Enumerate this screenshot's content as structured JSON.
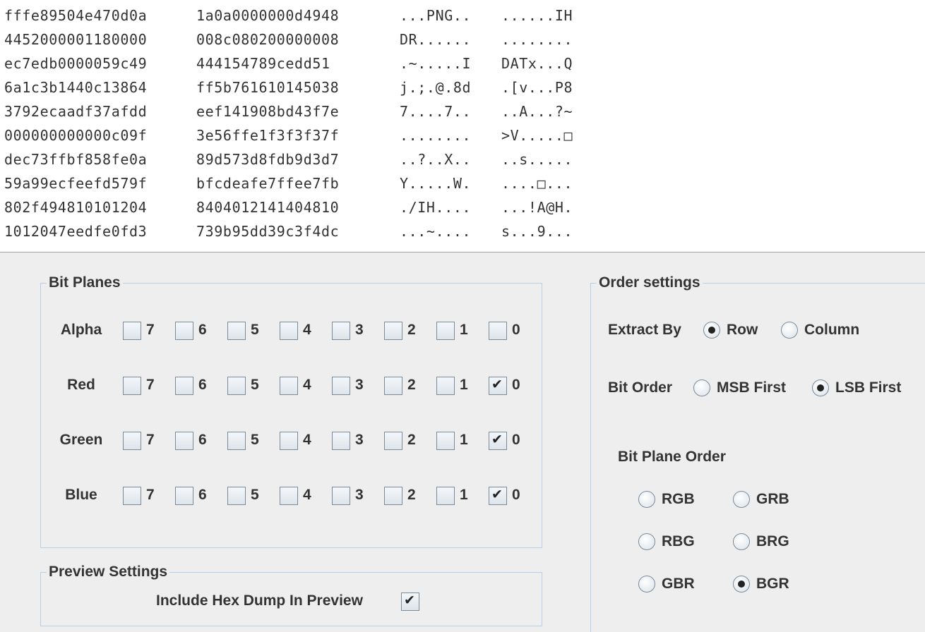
{
  "hex_dump": {
    "lines": [
      {
        "hex1": "fffe89504e470d0a",
        "hex2": "1a0a0000000d4948",
        "ascii1": "...PNG..",
        "ascii2": "......IH"
      },
      {
        "hex1": "4452000001180000",
        "hex2": "008c080200000008",
        "ascii1": "DR......",
        "ascii2": "........"
      },
      {
        "hex1": "ec7edb0000059c49",
        "hex2": "444154789cedd51",
        "ascii1": ".~.....I",
        "ascii2": "DATx...Q"
      },
      {
        "hex1": "6a1c3b1440c13864",
        "hex2": "ff5b761610145038",
        "ascii1": "j.;.@.8d",
        "ascii2": ".[v...P8"
      },
      {
        "hex1": "3792ecaadf37afdd",
        "hex2": "eef141908bd43f7e",
        "ascii1": "7....7..",
        "ascii2": "..A...?~"
      },
      {
        "hex1": "000000000000c09f",
        "hex2": "3e56ffe1f3f3f37f",
        "ascii1": "........",
        "ascii2": ">V.....□"
      },
      {
        "hex1": "dec73ffbf858fe0a",
        "hex2": "89d573d8fdb9d3d7",
        "ascii1": "..?..X..",
        "ascii2": "..s....."
      },
      {
        "hex1": "59a99ecfeefd579f",
        "hex2": "bfcdeafe7ffee7fb",
        "ascii1": "Y.....W.",
        "ascii2": "....□..."
      },
      {
        "hex1": "802f494810101204",
        "hex2": "8404012141404810",
        "ascii1": "./IH....",
        "ascii2": "...!A@H."
      },
      {
        "hex1": "1012047eedfe0fd3",
        "hex2": "739b95dd39c3f4dc",
        "ascii1": "...~....",
        "ascii2": "s...9..."
      }
    ]
  },
  "bit_planes": {
    "title": "Bit Planes",
    "rows": [
      {
        "label": "Alpha",
        "bits": [
          "7",
          "6",
          "5",
          "4",
          "3",
          "2",
          "1",
          "0"
        ],
        "checked": [
          false,
          false,
          false,
          false,
          false,
          false,
          false,
          false
        ]
      },
      {
        "label": "Red",
        "bits": [
          "7",
          "6",
          "5",
          "4",
          "3",
          "2",
          "1",
          "0"
        ],
        "checked": [
          false,
          false,
          false,
          false,
          false,
          false,
          false,
          true
        ]
      },
      {
        "label": "Green",
        "bits": [
          "7",
          "6",
          "5",
          "4",
          "3",
          "2",
          "1",
          "0"
        ],
        "checked": [
          false,
          false,
          false,
          false,
          false,
          false,
          false,
          true
        ]
      },
      {
        "label": "Blue",
        "bits": [
          "7",
          "6",
          "5",
          "4",
          "3",
          "2",
          "1",
          "0"
        ],
        "checked": [
          false,
          false,
          false,
          false,
          false,
          false,
          false,
          true
        ]
      }
    ]
  },
  "preview_settings": {
    "title": "Preview Settings",
    "include_hex_label": "Include Hex Dump In Preview",
    "include_hex_checked": true
  },
  "order_settings": {
    "title": "Order settings",
    "extract_by": {
      "label": "Extract By",
      "options": [
        "Row",
        "Column"
      ],
      "selected": "Row"
    },
    "bit_order": {
      "label": "Bit Order",
      "options": [
        "MSB First",
        "LSB First"
      ],
      "selected": "LSB First"
    },
    "bit_plane_order": {
      "label": "Bit Plane Order",
      "options": [
        "RGB",
        "GRB",
        "RBG",
        "BRG",
        "GBR",
        "BGR"
      ],
      "selected": "BGR"
    }
  }
}
